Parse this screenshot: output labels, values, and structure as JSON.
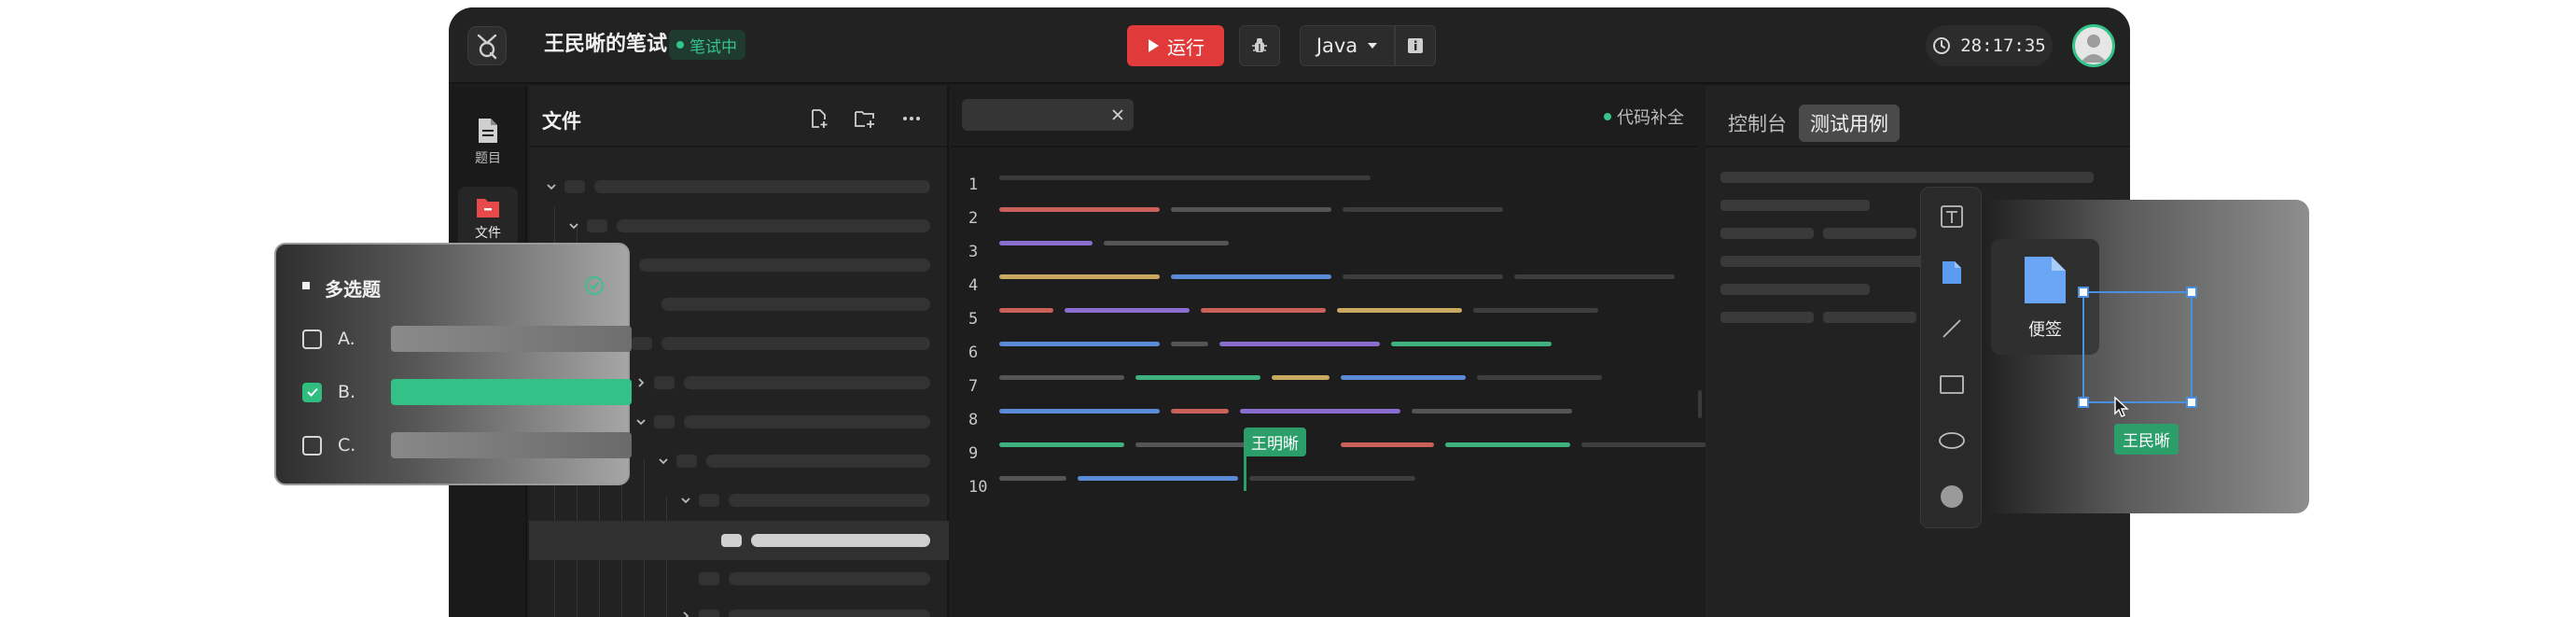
{
  "app": {
    "title": "王民晰的笔试",
    "status": "笔试中",
    "run_label": "运行",
    "language": "Java",
    "timer": "28:17:35"
  },
  "sidebar": {
    "items": [
      {
        "label": "题目",
        "icon": "document-icon"
      },
      {
        "label": "文件",
        "icon": "folder-icon"
      }
    ]
  },
  "files": {
    "title": "文件"
  },
  "editor": {
    "completion_label": "代码补全",
    "line_numbers": [
      "1",
      "2",
      "3",
      "4",
      "5",
      "6",
      "7",
      "8",
      "9",
      "10"
    ],
    "cursor_user": "王明晰"
  },
  "right_panel": {
    "tabs": [
      "控制台",
      "测试用例"
    ],
    "active_tab": "测试用例"
  },
  "whiteboard": {
    "sticky_label": "便签",
    "selection_user": "王民晰",
    "tools": [
      "text-tool-icon",
      "sticky-note-icon",
      "line-tool-icon",
      "rectangle-tool-icon",
      "ellipse-tool-icon",
      "fill-circle-icon"
    ]
  },
  "quiz": {
    "title": "多选题",
    "options": [
      {
        "label": "A.",
        "checked": false
      },
      {
        "label": "B.",
        "checked": true
      },
      {
        "label": "C.",
        "checked": false
      }
    ]
  },
  "colors": {
    "run_red": "#e03a3a",
    "accent_green": "#35c48a",
    "selection_blue": "#4a90e2",
    "code_red": "#c9605a",
    "code_blue": "#5b8bd6",
    "code_purple": "#8a6ecf",
    "code_yellow": "#c9a860",
    "code_green": "#3fb27f",
    "code_gray": "#4a4a4a"
  }
}
